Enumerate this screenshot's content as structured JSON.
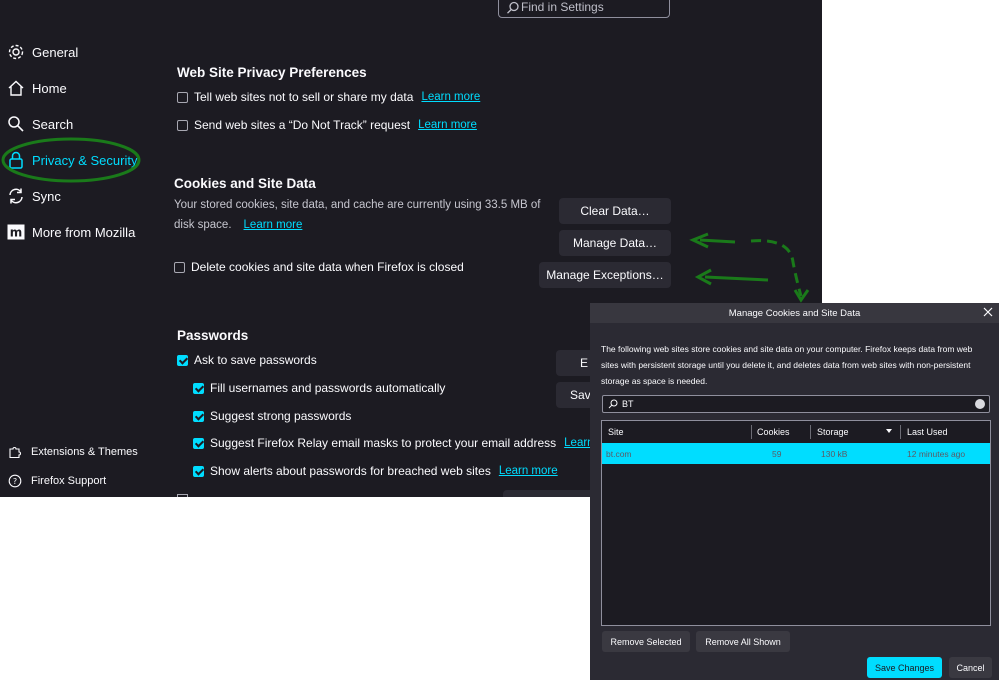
{
  "search": {
    "placeholder": "Find in Settings"
  },
  "sidebar": {
    "items": [
      {
        "label": "General",
        "icon": "gear-icon"
      },
      {
        "label": "Home",
        "icon": "home-icon"
      },
      {
        "label": "Search",
        "icon": "search-icon"
      },
      {
        "label": "Privacy & Security",
        "icon": "lock-icon",
        "active": true
      },
      {
        "label": "Sync",
        "icon": "sync-icon"
      },
      {
        "label": "More from Mozilla",
        "icon": "mozilla-icon"
      }
    ],
    "bottom": [
      {
        "label": "Extensions & Themes",
        "icon": "puzzle-icon"
      },
      {
        "label": "Firefox Support",
        "icon": "help-icon"
      }
    ]
  },
  "privacy_prefs": {
    "title": "Web Site Privacy Preferences",
    "options": [
      {
        "label": "Tell web sites not to sell or share my data",
        "link": "Learn more",
        "checked": false
      },
      {
        "label": "Send web sites a “Do Not Track” request",
        "link": "Learn more",
        "checked": false
      }
    ]
  },
  "cookies": {
    "title": "Cookies and Site Data",
    "desc_line1": "Your stored cookies, site data, and cache are currently using 33.5 MB of",
    "desc_line2": "disk space.",
    "link": "Learn more",
    "clear_btn": "Clear Data…",
    "manage_btn": "Manage Data…",
    "exceptions_btn": "Manage Exceptions…",
    "delete_label": "Delete cookies and site data when Firefox is closed"
  },
  "passwords": {
    "title": "Passwords",
    "ask_label": "Ask to save passwords",
    "options": [
      {
        "label": "Fill usernames and passwords automatically",
        "checked": true
      },
      {
        "label": "Suggest strong passwords",
        "checked": true
      },
      {
        "label": "Suggest Firefox Relay email masks to protect your email address",
        "link": "Learn more",
        "checked": true
      },
      {
        "label": "Show alerts about passwords for breached web sites",
        "link": "Learn more",
        "checked": true
      }
    ],
    "btn1": "E",
    "btn2": "Sav"
  },
  "dialog": {
    "title": "Manage Cookies and Site Data",
    "desc": "The following web sites store cookies and site data on your computer. Firefox keeps data from web sites with persistent storage until you delete it, and deletes data from web sites with non-persistent storage as space is needed.",
    "search_value": "BT",
    "columns": [
      "Site",
      "Cookies",
      "Storage",
      "Last Used"
    ],
    "rows": [
      {
        "site": "bt.com",
        "cookies": "59",
        "storage": "130 kB",
        "last_used": "12 minutes ago"
      }
    ],
    "remove_selected": "Remove Selected",
    "remove_all": "Remove All Shown",
    "save": "Save Changes",
    "cancel": "Cancel"
  },
  "colors": {
    "background": "#1c1b22",
    "accent": "#00ddff",
    "annotation": "#1a7a1a"
  }
}
